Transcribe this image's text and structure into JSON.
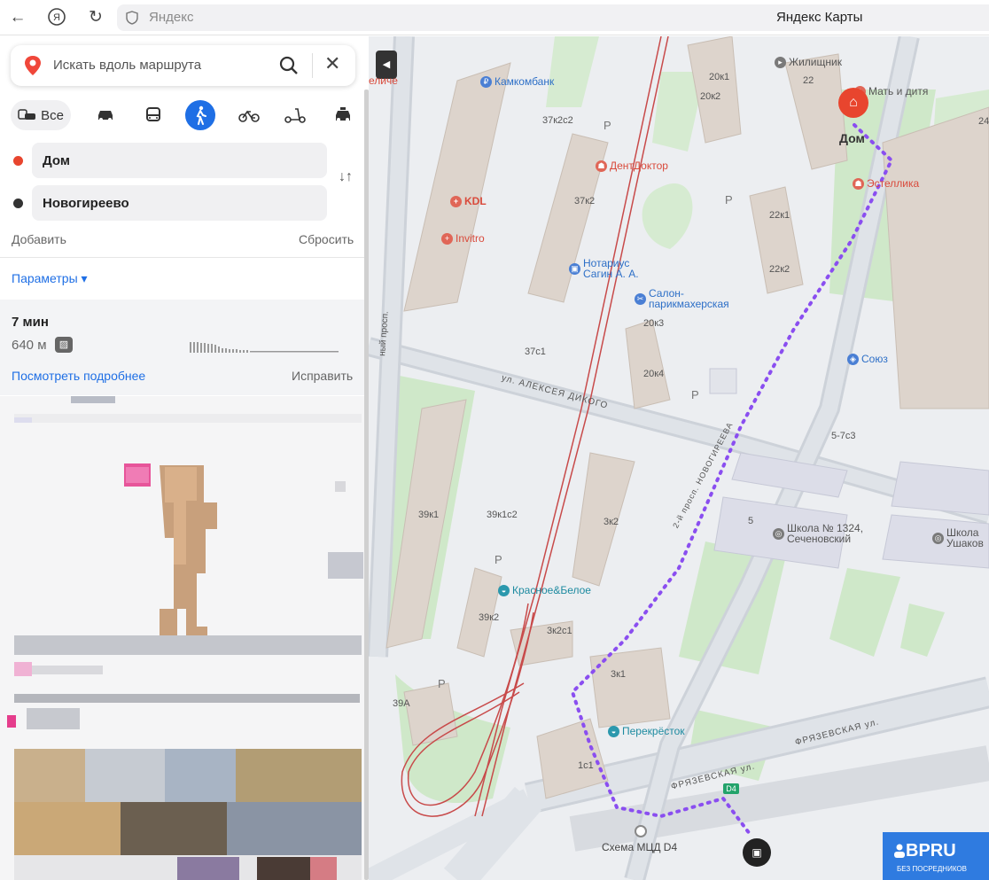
{
  "browser": {
    "back_icon": "arrow-left-icon",
    "ya_icon": "yandex-icon",
    "reload_icon": "reload-icon",
    "host": "Яндекс",
    "title": "Яндекс Карты"
  },
  "sidebar": {
    "search_placeholder": "Искать вдоль маршрута",
    "modes": {
      "all_label": "Все",
      "items": [
        "car-icon",
        "bus-icon",
        "walk-icon",
        "bike-icon",
        "scooter-icon",
        "taxi-icon"
      ],
      "active": "walk-icon"
    },
    "route_points": {
      "from": "Дом",
      "to": "Новогиреево",
      "from_color": "#e8452e",
      "to_color": "#333333"
    },
    "add_label": "Добавить",
    "reset_label": "Сбросить",
    "params_label": "Параметры ▾",
    "route": {
      "time": "7 мин",
      "distance": "640 м",
      "details_link": "Посмотреть подробнее",
      "fix_link": "Исправить"
    },
    "accent_color": "#1f6fe5"
  },
  "map": {
    "streets": [
      "ул. АЛЕКСЕЯ ДИКОГО",
      "2-й просп. НОВОГИРЕЕВА",
      "ФРЯЗЕВСКАЯ ул.",
      "ФРЯЗЕВСКАЯ ул.",
      "ный просп."
    ],
    "buildings": [
      "20к1",
      "20к2",
      "22",
      "37к2с2",
      "37к2",
      "22к1",
      "22к2",
      "20к3",
      "20к4",
      "37с1",
      "5-7с3",
      "39к1",
      "39к1с2",
      "3к2",
      "5",
      "39к2",
      "3к2с1",
      "3к1",
      "39А",
      "1с1",
      "24"
    ],
    "pois": {
      "kamkombank": "Камкомбанк",
      "zhilishnik": "Жилищник",
      "mat_i_ditya": "Мать и дитя",
      "dent_doctor": "ДентДоктор",
      "estellika": "Эстеллика",
      "kdl": "KDL",
      "invitro": "Invitro",
      "notarius": "Нотариус\nСагин А. А.",
      "salon": "Салон-\nпарикмахерская",
      "soyuz": "Союз",
      "school_1324": "Школа № 1324,\nСеченовский",
      "school_2": "Школа\nУшаков",
      "krasnoe_beloe": "Красное&Белое",
      "perekrestok": "Перекрёсток",
      "velichie": "еличе"
    },
    "home_label": "Дом",
    "mcd_label": "Схема МЦД D4",
    "d4": "D4",
    "parking": "P",
    "route_color": "#8a4ef0",
    "rail_color": "#c84a4a"
  },
  "badge": {
    "name": "BPRU",
    "tagline": "БЕЗ ПОСРЕДНИКОВ"
  }
}
